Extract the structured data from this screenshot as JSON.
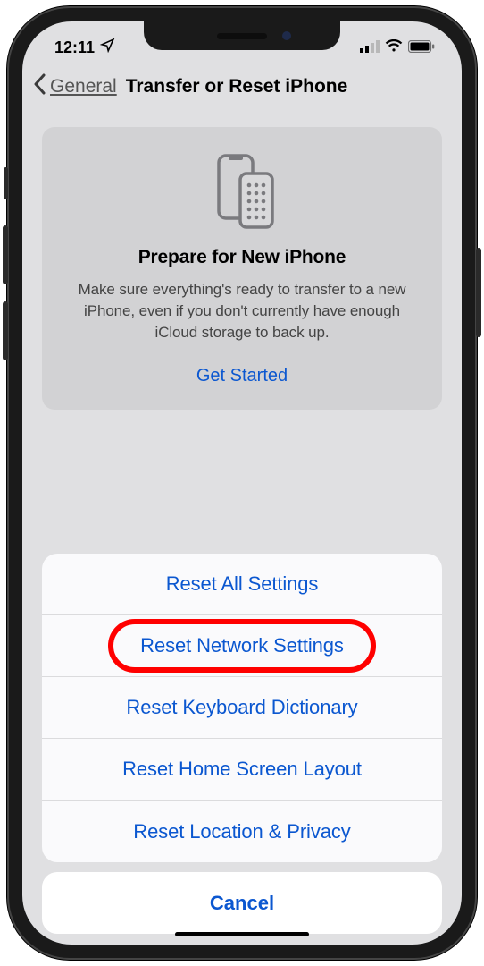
{
  "status": {
    "time": "12:11",
    "location_icon": "location-arrow"
  },
  "nav": {
    "back_label": "General",
    "title": "Transfer or Reset iPhone"
  },
  "prepare_card": {
    "title": "Prepare for New iPhone",
    "description": "Make sure everything's ready to transfer to a new iPhone, even if you don't currently have enough iCloud storage to back up.",
    "action": "Get Started"
  },
  "sheet": {
    "items": [
      "Reset All Settings",
      "Reset Network Settings",
      "Reset Keyboard Dictionary",
      "Reset Home Screen Layout",
      "Reset Location & Privacy"
    ],
    "highlighted_index": 1,
    "cancel": "Cancel"
  }
}
